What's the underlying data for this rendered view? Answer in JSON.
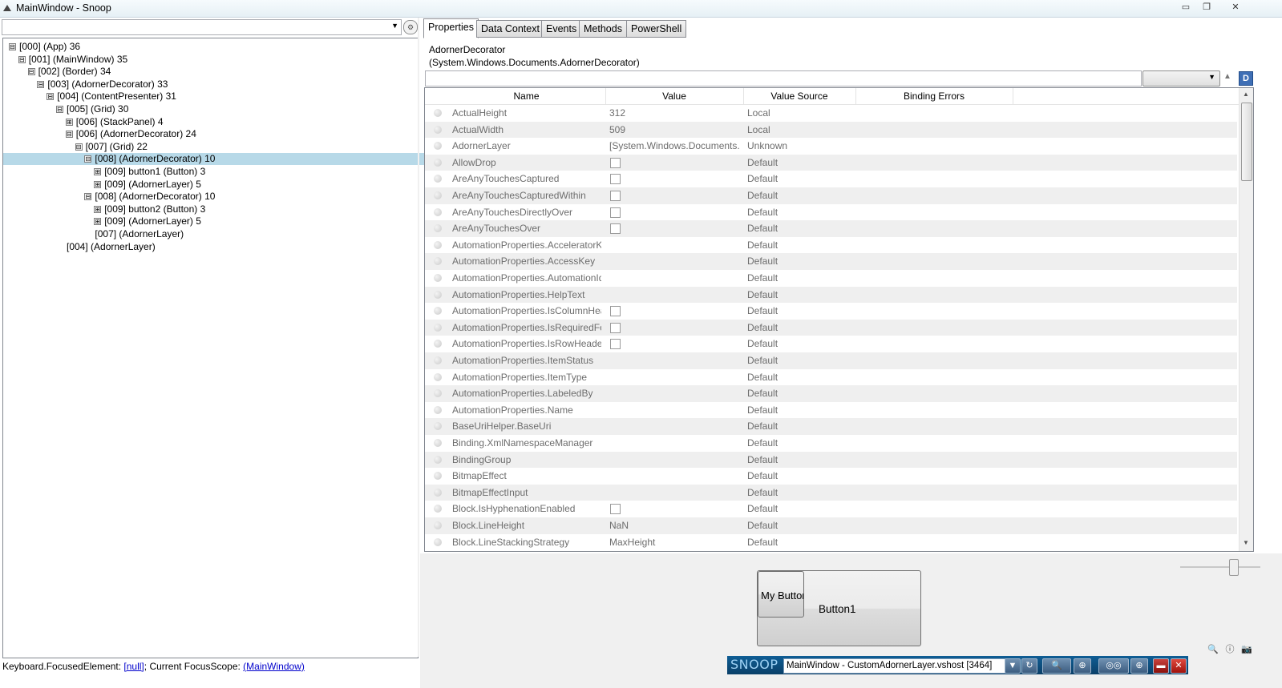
{
  "window": {
    "title": "MainWindow - Snoop",
    "controls": {
      "minimize": "▭",
      "restore": "❐",
      "close": "✕"
    }
  },
  "search": {
    "value": "",
    "placeholder": ""
  },
  "tree": [
    {
      "label": "[000]  (App) 36",
      "toggle": "⊟",
      "depth": 0
    },
    {
      "label": "[001]  (MainWindow) 35",
      "toggle": "⊟",
      "depth": 1
    },
    {
      "label": "[002]  (Border) 34",
      "toggle": "⊟",
      "depth": 2
    },
    {
      "label": "[003]  (AdornerDecorator) 33",
      "toggle": "⊟",
      "depth": 3
    },
    {
      "label": "[004]  (ContentPresenter) 31",
      "toggle": "⊟",
      "depth": 4
    },
    {
      "label": "[005]  (Grid) 30",
      "toggle": "⊟",
      "depth": 5
    },
    {
      "label": "[006]  (StackPanel) 4",
      "toggle": "⊞",
      "depth": 6
    },
    {
      "label": "[006]  (AdornerDecorator) 24",
      "toggle": "⊟",
      "depth": 6
    },
    {
      "label": "[007]  (Grid) 22",
      "toggle": "⊟",
      "depth": 7
    },
    {
      "label": "[008]  (AdornerDecorator) 10",
      "toggle": "⊟",
      "depth": 8,
      "selected": true
    },
    {
      "label": "[009] button1 (Button) 3",
      "toggle": "⊞",
      "depth": 9
    },
    {
      "label": "[009]  (AdornerLayer) 5",
      "toggle": "⊞",
      "depth": 9
    },
    {
      "label": "[008]  (AdornerDecorator) 10",
      "toggle": "⊟",
      "depth": 8
    },
    {
      "label": "[009] button2 (Button) 3",
      "toggle": "⊞",
      "depth": 9
    },
    {
      "label": "[009]  (AdornerLayer) 5",
      "toggle": "⊞",
      "depth": 9
    },
    {
      "label": "[007]  (AdornerLayer)",
      "toggle": "",
      "depth": 8
    },
    {
      "label": "[004]  (AdornerLayer)",
      "toggle": "",
      "depth": 5
    }
  ],
  "focus": {
    "prefix": "Keyboard.FocusedElement: ",
    "element": "[null]",
    "mid": "; Current FocusScope: ",
    "scope": "(MainWindow)"
  },
  "tabs": [
    "Properties",
    "Data Context",
    "Events",
    "Methods",
    "PowerShell"
  ],
  "active_tab": 0,
  "selected_object": {
    "name": "AdornerDecorator",
    "type": "(System.Windows.Documents.AdornerDecorator)"
  },
  "prop_filter": {
    "value": "",
    "placeholder": ""
  },
  "prop_combo": {
    "value": ""
  },
  "d_button": "D",
  "columns": [
    "Name",
    "Value",
    "Value Source",
    "Binding Errors"
  ],
  "properties": [
    {
      "name": "ActualHeight",
      "value": "312",
      "source": "Local"
    },
    {
      "name": "ActualWidth",
      "value": "509",
      "source": "Local"
    },
    {
      "name": "AdornerLayer",
      "value": "[System.Windows.Documents.AdornerLayer]",
      "source": "Unknown"
    },
    {
      "name": "AllowDrop",
      "value": "",
      "checkbox": true,
      "source": "Default"
    },
    {
      "name": "AreAnyTouchesCaptured",
      "value": "",
      "checkbox": true,
      "source": "Default"
    },
    {
      "name": "AreAnyTouchesCapturedWithin",
      "value": "",
      "checkbox": true,
      "source": "Default"
    },
    {
      "name": "AreAnyTouchesDirectlyOver",
      "value": "",
      "checkbox": true,
      "source": "Default"
    },
    {
      "name": "AreAnyTouchesOver",
      "value": "",
      "checkbox": true,
      "source": "Default"
    },
    {
      "name": "AutomationProperties.AcceleratorKey",
      "value": "",
      "source": "Default"
    },
    {
      "name": "AutomationProperties.AccessKey",
      "value": "",
      "source": "Default"
    },
    {
      "name": "AutomationProperties.AutomationId",
      "value": "",
      "source": "Default"
    },
    {
      "name": "AutomationProperties.HelpText",
      "value": "",
      "source": "Default"
    },
    {
      "name": "AutomationProperties.IsColumnHeader",
      "value": "",
      "checkbox": true,
      "source": "Default"
    },
    {
      "name": "AutomationProperties.IsRequiredForForm",
      "value": "",
      "checkbox": true,
      "source": "Default"
    },
    {
      "name": "AutomationProperties.IsRowHeader",
      "value": "",
      "checkbox": true,
      "source": "Default"
    },
    {
      "name": "AutomationProperties.ItemStatus",
      "value": "",
      "source": "Default"
    },
    {
      "name": "AutomationProperties.ItemType",
      "value": "",
      "source": "Default"
    },
    {
      "name": "AutomationProperties.LabeledBy",
      "value": "",
      "source": "Default"
    },
    {
      "name": "AutomationProperties.Name",
      "value": "",
      "source": "Default"
    },
    {
      "name": "BaseUriHelper.BaseUri",
      "value": "",
      "source": "Default"
    },
    {
      "name": "Binding.XmlNamespaceManager",
      "value": "",
      "source": "Default"
    },
    {
      "name": "BindingGroup",
      "value": "",
      "source": "Default"
    },
    {
      "name": "BitmapEffect",
      "value": "",
      "source": "Default"
    },
    {
      "name": "BitmapEffectInput",
      "value": "",
      "source": "Default"
    },
    {
      "name": "Block.IsHyphenationEnabled",
      "value": "",
      "checkbox": true,
      "source": "Default"
    },
    {
      "name": "Block.LineHeight",
      "value": "NaN",
      "source": "Default"
    },
    {
      "name": "Block.LineStackingStrategy",
      "value": "MaxHeight",
      "source": "Default"
    }
  ],
  "preview": {
    "button1_label": "Button1",
    "mybutton_label": "My Button"
  },
  "preview_tools": {
    "zoom": "🔍",
    "info": "ⓘ",
    "snapshot": "📷"
  },
  "snoop_bar": {
    "logo": "SNOOP",
    "window_selector": "MainWindow - CustomAdornerLayer.vshost [3464]",
    "buttons": {
      "dropdown": "▼",
      "refresh": "↻",
      "magnify": "🔍",
      "crosshair": "⊕",
      "binoculars": "◎◎",
      "target": "⊕",
      "minimize": "▬",
      "close": "✕"
    }
  },
  "colors": {
    "selected_row": "#b7d9e8",
    "snoop_blue": "#0f5e95",
    "link": "#0000cc"
  }
}
